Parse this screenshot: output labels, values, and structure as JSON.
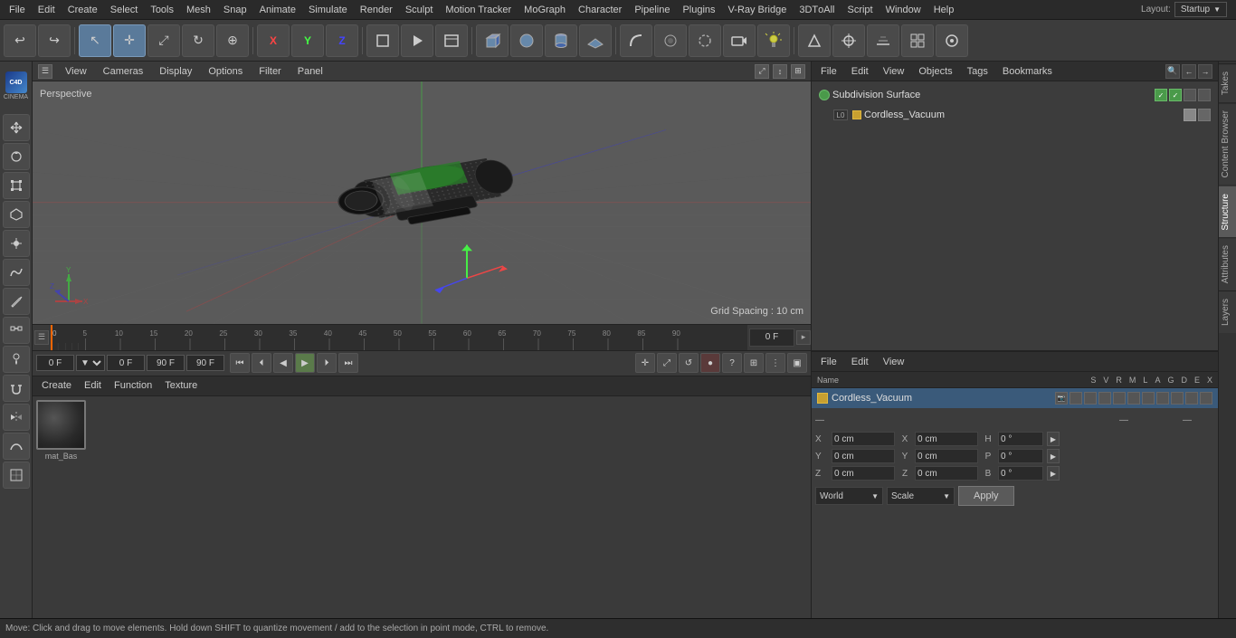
{
  "app": {
    "title": "Cinema 4D",
    "layout": "Startup"
  },
  "menu": {
    "items": [
      "File",
      "Edit",
      "Create",
      "Select",
      "Tools",
      "Mesh",
      "Snap",
      "Animate",
      "Simulate",
      "Render",
      "Sculpt",
      "Motion Tracker",
      "MoGraph",
      "Character",
      "Pipeline",
      "Plugins",
      "V-Ray Bridge",
      "3DTоAll",
      "Script",
      "Window",
      "Help"
    ]
  },
  "toolbar": {
    "layout_label": "Layout:",
    "layout_value": "Startup"
  },
  "viewport": {
    "perspective_label": "Perspective",
    "header_items": [
      "View",
      "Cameras",
      "Display",
      "Options",
      "Filter",
      "Panel"
    ],
    "grid_spacing": "Grid Spacing : 10 cm"
  },
  "object_manager": {
    "header_items": [
      "File",
      "Edit",
      "View",
      "Objects",
      "Tags",
      "Bookmarks"
    ],
    "objects": [
      {
        "name": "Subdivision Surface",
        "dot_color": "green",
        "indent": false,
        "checkbox": true
      },
      {
        "name": "Cordless_Vacuum",
        "dot_color": "yellow",
        "indent": true,
        "checkbox": false
      }
    ]
  },
  "attribute_manager": {
    "header_items": [
      "File",
      "Edit",
      "View"
    ],
    "col_headers": [
      "Name",
      "S",
      "V",
      "R",
      "M",
      "L",
      "A",
      "G",
      "D",
      "E",
      "X"
    ],
    "object_name": "Cordless_Vacuum"
  },
  "timeline": {
    "ticks": [
      0,
      5,
      10,
      15,
      20,
      25,
      30,
      35,
      40,
      45,
      50,
      55,
      60,
      65,
      70,
      75,
      80,
      85,
      90
    ],
    "start_frame": "0 F",
    "end_frame": "90 F",
    "current_frame": "0 F"
  },
  "playback": {
    "current_frame": "0 F",
    "start_frame": "0 F",
    "preview_start": "90 F",
    "preview_end": "90 F"
  },
  "coordinates": {
    "x_pos": "0 cm",
    "y_pos": "0 cm",
    "z_pos": "0 cm",
    "x_size": "0 cm",
    "y_size": "0 cm",
    "z_size": "0 cm",
    "h_rot": "0 °",
    "p_rot": "0 °",
    "b_rot": "0 °",
    "world_label": "World",
    "scale_label": "Scale",
    "apply_label": "Apply"
  },
  "material": {
    "name": "mat_Bas"
  },
  "status_bar": {
    "message": "Move: Click and drag to move elements. Hold down SHIFT to quantize movement / add to the selection in point mode, CTRL to remove."
  },
  "right_tabs": [
    "Takes",
    "Content Browser",
    "Structure",
    "Attributes",
    "Layers"
  ],
  "icons": {
    "undo": "↩",
    "redo": "↪",
    "move": "✛",
    "scale": "⤢",
    "rotate": "↻",
    "cursor": "↖",
    "transform": "⊕",
    "x_axis": "X",
    "y_axis": "Y",
    "z_axis": "Z",
    "cube": "▣",
    "sphere": "●",
    "camera": "📷",
    "light": "☀",
    "play": "▶",
    "stop": "■",
    "prev": "◀",
    "next": "▶",
    "first": "⏮",
    "last": "⏭",
    "record": "●",
    "question": "?",
    "grid": "⊞",
    "search": "🔍",
    "settings": "⚙"
  }
}
